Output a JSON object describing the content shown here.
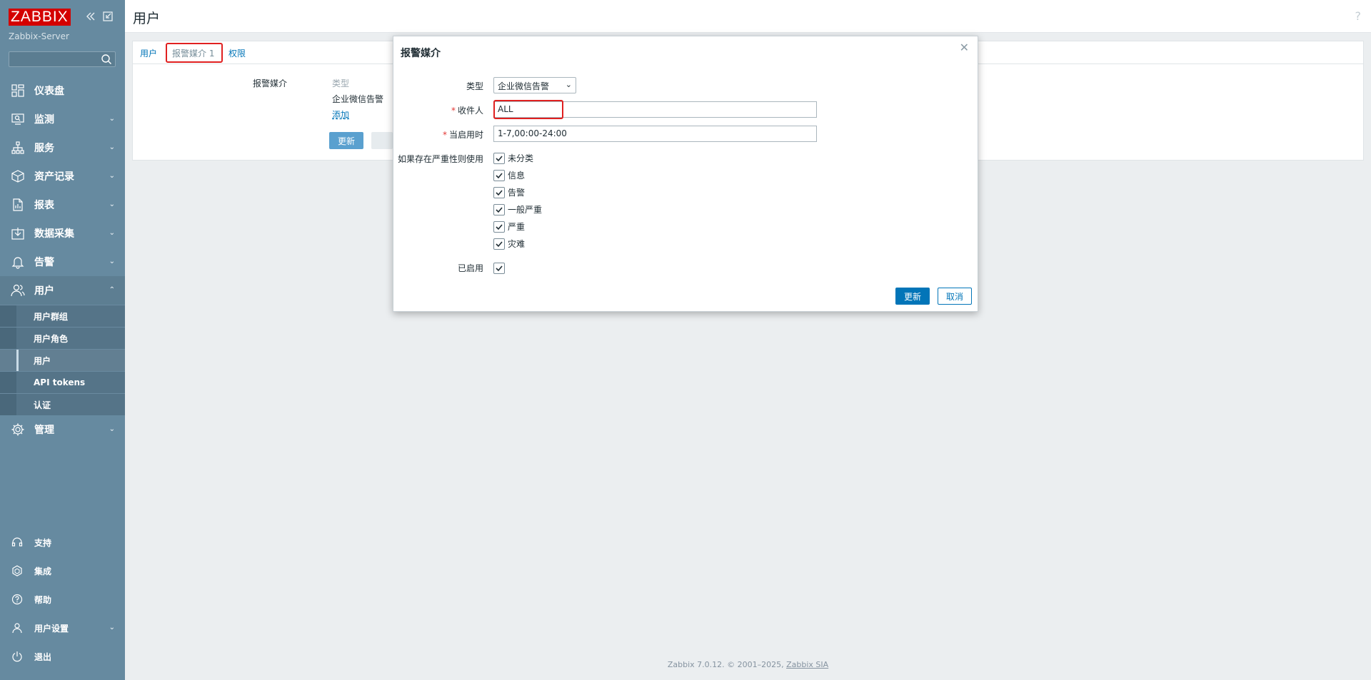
{
  "app": {
    "logo": "ZABBIX",
    "server_name": "Zabbix-Server",
    "page_title": "用户",
    "help": "?"
  },
  "sidebar": {
    "items": [
      {
        "label": "仪表盘",
        "icon": "dashboard-icon"
      },
      {
        "label": "监测",
        "icon": "monitoring-icon"
      },
      {
        "label": "服务",
        "icon": "services-icon"
      },
      {
        "label": "资产记录",
        "icon": "inventory-icon"
      },
      {
        "label": "报表",
        "icon": "reports-icon"
      },
      {
        "label": "数据采集",
        "icon": "data-collection-icon"
      },
      {
        "label": "告警",
        "icon": "alerts-icon"
      },
      {
        "label": "用户",
        "icon": "users-icon"
      },
      {
        "label": "管理",
        "icon": "administration-icon"
      }
    ],
    "users_submenu": [
      {
        "label": "用户群组"
      },
      {
        "label": "用户角色"
      },
      {
        "label": "用户"
      },
      {
        "label": "API tokens"
      },
      {
        "label": "认证"
      }
    ],
    "bottom_items": [
      {
        "label": "支持",
        "icon": "headset-icon"
      },
      {
        "label": "集成",
        "icon": "integrations-icon"
      },
      {
        "label": "帮助",
        "icon": "help-icon"
      },
      {
        "label": "用户设置",
        "icon": "user-settings-icon"
      },
      {
        "label": "退出",
        "icon": "power-icon"
      }
    ]
  },
  "tabs": {
    "user": "用户",
    "media": "报警媒介",
    "media_count": "1",
    "permissions": "权限"
  },
  "media_form": {
    "label": "报警媒介",
    "col_type": "类型",
    "row_type": "企业微信告警",
    "add_link": "添加",
    "update_btn": "更新"
  },
  "modal": {
    "title": "报警媒介",
    "type_label": "类型",
    "type_value": "企业微信告警",
    "sendto_label": "收件人",
    "sendto_value": "ALL",
    "when_label": "当启用时",
    "when_value": "1-7,00:00-24:00",
    "severity_label": "如果存在严重性则使用",
    "severities": [
      {
        "label": "未分类",
        "checked": true
      },
      {
        "label": "信息",
        "checked": true
      },
      {
        "label": "告警",
        "checked": true
      },
      {
        "label": "一般严重",
        "checked": true
      },
      {
        "label": "严重",
        "checked": true
      },
      {
        "label": "灾难",
        "checked": true
      }
    ],
    "enabled_label": "已启用",
    "enabled": true,
    "update_btn": "更新",
    "cancel_btn": "取消"
  },
  "footer": {
    "text": "Zabbix 7.0.12. © 2001–2025, ",
    "link": "Zabbix SIA"
  },
  "colors": {
    "sidebar": "#668aa0",
    "logo": "#d40000",
    "primary": "#0275b8",
    "highlight": "#e02020"
  }
}
